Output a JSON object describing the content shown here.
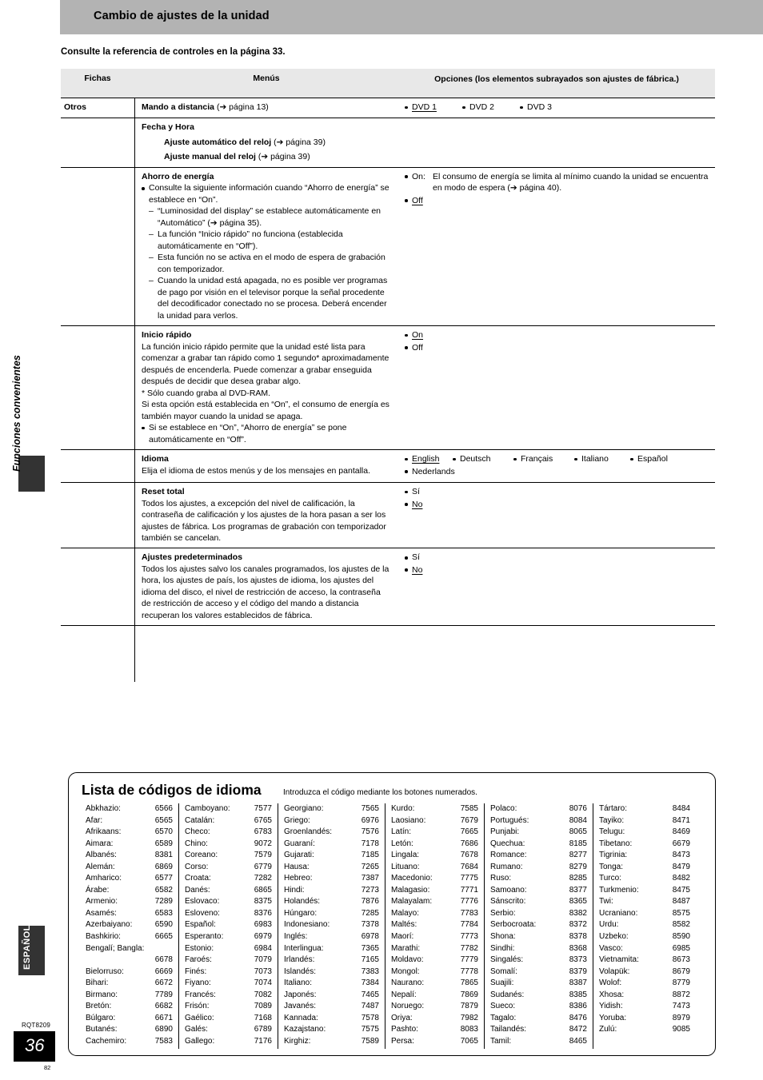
{
  "header": {
    "title": "Cambio de ajustes de la unidad"
  },
  "intro": "Consulte la referencia de controles en la página 33.",
  "table": {
    "headers": {
      "fichas": "Fichas",
      "menus": "Menús",
      "opciones": "Opciones (los elementos subrayados son ajustes de fábrica.)"
    },
    "group_label": "Otros",
    "rows": {
      "remote": {
        "menu_title": "Mando a distancia",
        "menu_ref": "(➔ página 13)",
        "options": [
          "DVD 1",
          "DVD 2",
          "DVD 3"
        ],
        "default": "DVD 1"
      },
      "datetime": {
        "menu_title": "Fecha y Hora",
        "sub1_title": "Ajuste automático del reloj",
        "sub1_ref": "(➔ página 39)",
        "sub2_title": "Ajuste manual del reloj",
        "sub2_ref": "(➔ página 39)"
      },
      "power_save": {
        "menu_title": "Ahorro de energía",
        "bullet": "Consulte la siguiente información cuando “Ahorro de energía” se establece en “On”.",
        "dashes": [
          "“Luminosidad del display” se establece automáticamente en “Automático” (➔ página 35).",
          "La función “Inicio rápido” no funciona (establecida automáticamente en “Off”).",
          "Esta función no se activa en el modo de espera de grabación con temporizador.",
          "Cuando la unidad está apagada, no es posible ver programas de pago por visión en el televisor porque la señal procedente del decodificador conectado no se procesa. Deberá encender la unidad para verlos."
        ],
        "opt_on_key": "On:",
        "opt_on_text": "El consumo de energía se limita al mínimo cuando la unidad se encuentra en modo de espera (➔ página 40).",
        "opt_off": "Off"
      },
      "quick_start": {
        "menu_title": "Inicio rápido",
        "body": "La función inicio rápido permite que la unidad esté lista para comenzar a grabar tan rápido como 1 segundo* aproximadamente después de encenderla. Puede comenzar a grabar enseguida después de decidir que desea grabar algo.",
        "footnote": "* Sólo cuando graba al DVD-RAM.",
        "body2": "Si esta opción está establecida en “On”, el consumo de energía es también mayor cuando la unidad se apaga.",
        "bullet": "Si se establece en “On”, “Ahorro de energía” se pone automáticamente en “Off”.",
        "options": [
          "On",
          "Off"
        ],
        "default": "On"
      },
      "language": {
        "menu_title": "Idioma",
        "body": "Elija el idioma de estos menús y de los mensajes en pantalla.",
        "options": [
          "English",
          "Deutsch",
          "Français",
          "Italiano",
          "Español",
          "Nederlands"
        ],
        "default": "English"
      },
      "reset_all": {
        "menu_title": "Reset total",
        "body": "Todos los ajustes, a excepción del nivel de calificación, la contraseña de calificación y los ajustes de la hora pasan a ser los ajustes de fábrica. Los programas de grabación con temporizador también se cancelan.",
        "options": [
          "Sí",
          "No"
        ],
        "default": "No"
      },
      "defaults": {
        "menu_title": "Ajustes predeterminados",
        "body": "Todos los ajustes salvo los canales programados, los ajustes de la hora, los ajustes de país, los ajustes de idioma, los ajustes del idioma del disco, el nivel de restricción de acceso, la contraseña de restricción de acceso y el código del mando a distancia recuperan los valores establecidos de fábrica.",
        "options": [
          "Sí",
          "No"
        ],
        "default": "No"
      }
    }
  },
  "sidebar": {
    "section_label": "Funciones convenientes",
    "language_tab": "ESPAÑOL",
    "doc_code": "RQT8209",
    "page_number": "36",
    "folio": "82"
  },
  "language_codes": {
    "title": "Lista de códigos de idioma",
    "subtitle": "Introduzca el código mediante los botones numerados.",
    "columns": [
      [
        {
          "name": "Abkhazio:",
          "code": "6566"
        },
        {
          "name": "Afar:",
          "code": "6565"
        },
        {
          "name": "Afrikaans:",
          "code": "6570"
        },
        {
          "name": "Aimara:",
          "code": "6589"
        },
        {
          "name": "Albanés:",
          "code": "8381"
        },
        {
          "name": "Alemán:",
          "code": "6869"
        },
        {
          "name": "Amharico:",
          "code": "6577"
        },
        {
          "name": "Árabe:",
          "code": "6582"
        },
        {
          "name": "Armenio:",
          "code": "7289"
        },
        {
          "name": "Asamés:",
          "code": "6583"
        },
        {
          "name": "Azerbaiyano:",
          "code": "6590"
        },
        {
          "name": "Bashkirio:",
          "code": "6665"
        },
        {
          "name": "Bengalí; Bangla:",
          "code": ""
        },
        {
          "name": "",
          "code": "6678"
        },
        {
          "name": "Bielorruso:",
          "code": "6669"
        },
        {
          "name": "Bihari:",
          "code": "6672"
        },
        {
          "name": "Birmano:",
          "code": "7789"
        },
        {
          "name": "Bretón:",
          "code": "6682"
        },
        {
          "name": "Búlgaro:",
          "code": "6671"
        },
        {
          "name": "Butanés:",
          "code": "6890"
        },
        {
          "name": "Cachemiro:",
          "code": "7583"
        }
      ],
      [
        {
          "name": "Camboyano:",
          "code": "7577"
        },
        {
          "name": "Catalán:",
          "code": "6765"
        },
        {
          "name": "Checo:",
          "code": "6783"
        },
        {
          "name": "Chino:",
          "code": "9072"
        },
        {
          "name": "Coreano:",
          "code": "7579"
        },
        {
          "name": "Corso:",
          "code": "6779"
        },
        {
          "name": "Croata:",
          "code": "7282"
        },
        {
          "name": "Danés:",
          "code": "6865"
        },
        {
          "name": "Eslovaco:",
          "code": "8375"
        },
        {
          "name": "Esloveno:",
          "code": "8376"
        },
        {
          "name": "Español:",
          "code": "6983"
        },
        {
          "name": "Esperanto:",
          "code": "6979"
        },
        {
          "name": "Estonio:",
          "code": "6984"
        },
        {
          "name": "Faroés:",
          "code": "7079"
        },
        {
          "name": "Finés:",
          "code": "7073"
        },
        {
          "name": "Fiyano:",
          "code": "7074"
        },
        {
          "name": "Francés:",
          "code": "7082"
        },
        {
          "name": "Frisón:",
          "code": "7089"
        },
        {
          "name": "Gaélico:",
          "code": "7168"
        },
        {
          "name": "Galés:",
          "code": "6789"
        },
        {
          "name": "Gallego:",
          "code": "7176"
        }
      ],
      [
        {
          "name": "Georgiano:",
          "code": "7565"
        },
        {
          "name": "Griego:",
          "code": "6976"
        },
        {
          "name": "Groenlandés:",
          "code": "7576"
        },
        {
          "name": "Guaraní:",
          "code": "7178"
        },
        {
          "name": "Gujarati:",
          "code": "7185"
        },
        {
          "name": "Hausa:",
          "code": "7265"
        },
        {
          "name": "Hebreo:",
          "code": "7387"
        },
        {
          "name": "Hindi:",
          "code": "7273"
        },
        {
          "name": "Holandés:",
          "code": "7876"
        },
        {
          "name": "Húngaro:",
          "code": "7285"
        },
        {
          "name": "Indonesiano:",
          "code": "7378"
        },
        {
          "name": "Inglés:",
          "code": "6978"
        },
        {
          "name": "Interlingua:",
          "code": "7365"
        },
        {
          "name": "Irlandés:",
          "code": "7165"
        },
        {
          "name": "Islandés:",
          "code": "7383"
        },
        {
          "name": "Italiano:",
          "code": "7384"
        },
        {
          "name": "Japonés:",
          "code": "7465"
        },
        {
          "name": "Javanés:",
          "code": "7487"
        },
        {
          "name": "Kannada:",
          "code": "7578"
        },
        {
          "name": "Kazajstano:",
          "code": "7575"
        },
        {
          "name": "Kirghiz:",
          "code": "7589"
        }
      ],
      [
        {
          "name": "Kurdo:",
          "code": "7585"
        },
        {
          "name": "Laosiano:",
          "code": "7679"
        },
        {
          "name": "Latín:",
          "code": "7665"
        },
        {
          "name": "Letón:",
          "code": "7686"
        },
        {
          "name": "Lingala:",
          "code": "7678"
        },
        {
          "name": "Lituano:",
          "code": "7684"
        },
        {
          "name": "Macedonio:",
          "code": "7775"
        },
        {
          "name": "Malagasio:",
          "code": "7771"
        },
        {
          "name": "Malayalam:",
          "code": "7776"
        },
        {
          "name": "Malayo:",
          "code": "7783"
        },
        {
          "name": "Maltés:",
          "code": "7784"
        },
        {
          "name": "Maorí:",
          "code": "7773"
        },
        {
          "name": "Marathi:",
          "code": "7782"
        },
        {
          "name": "Moldavo:",
          "code": "7779"
        },
        {
          "name": "Mongol:",
          "code": "7778"
        },
        {
          "name": "Naurano:",
          "code": "7865"
        },
        {
          "name": "Nepalí:",
          "code": "7869"
        },
        {
          "name": "Noruego:",
          "code": "7879"
        },
        {
          "name": "Oriya:",
          "code": "7982"
        },
        {
          "name": "Pashto:",
          "code": "8083"
        },
        {
          "name": "Persa:",
          "code": "7065"
        }
      ],
      [
        {
          "name": "Polaco:",
          "code": "8076"
        },
        {
          "name": "Portugués:",
          "code": "8084"
        },
        {
          "name": "Punjabi:",
          "code": "8065"
        },
        {
          "name": "Quechua:",
          "code": "8185"
        },
        {
          "name": "Romance:",
          "code": "8277"
        },
        {
          "name": "Rumano:",
          "code": "8279"
        },
        {
          "name": "Ruso:",
          "code": "8285"
        },
        {
          "name": "Samoano:",
          "code": "8377"
        },
        {
          "name": "Sánscrito:",
          "code": "8365"
        },
        {
          "name": "Serbio:",
          "code": "8382"
        },
        {
          "name": "Serbocroata:",
          "code": "8372"
        },
        {
          "name": "Shona:",
          "code": "8378"
        },
        {
          "name": "Sindhi:",
          "code": "8368"
        },
        {
          "name": "Singalés:",
          "code": "8373"
        },
        {
          "name": "Somalí:",
          "code": "8379"
        },
        {
          "name": "Suajili:",
          "code": "8387"
        },
        {
          "name": "Sudanés:",
          "code": "8385"
        },
        {
          "name": "Sueco:",
          "code": "8386"
        },
        {
          "name": "Tagalo:",
          "code": "8476"
        },
        {
          "name": "Tailandés:",
          "code": "8472"
        },
        {
          "name": "Tamil:",
          "code": "8465"
        }
      ],
      [
        {
          "name": "Tártaro:",
          "code": "8484"
        },
        {
          "name": "Tayiko:",
          "code": "8471"
        },
        {
          "name": "Telugu:",
          "code": "8469"
        },
        {
          "name": "Tibetano:",
          "code": "6679"
        },
        {
          "name": "Tigrinia:",
          "code": "8473"
        },
        {
          "name": "Tonga:",
          "code": "8479"
        },
        {
          "name": "Turco:",
          "code": "8482"
        },
        {
          "name": "Turkmenio:",
          "code": "8475"
        },
        {
          "name": "Twi:",
          "code": "8487"
        },
        {
          "name": "Ucraniano:",
          "code": "8575"
        },
        {
          "name": "Urdu:",
          "code": "8582"
        },
        {
          "name": "Uzbeko:",
          "code": "8590"
        },
        {
          "name": "Vasco:",
          "code": "6985"
        },
        {
          "name": "Vietnamita:",
          "code": "8673"
        },
        {
          "name": "Volapük:",
          "code": "8679"
        },
        {
          "name": "Wolof:",
          "code": "8779"
        },
        {
          "name": "Xhosa:",
          "code": "8872"
        },
        {
          "name": "Yidish:",
          "code": "7473"
        },
        {
          "name": "Yoruba:",
          "code": "8979"
        },
        {
          "name": "Zulú:",
          "code": "9085"
        }
      ]
    ]
  }
}
